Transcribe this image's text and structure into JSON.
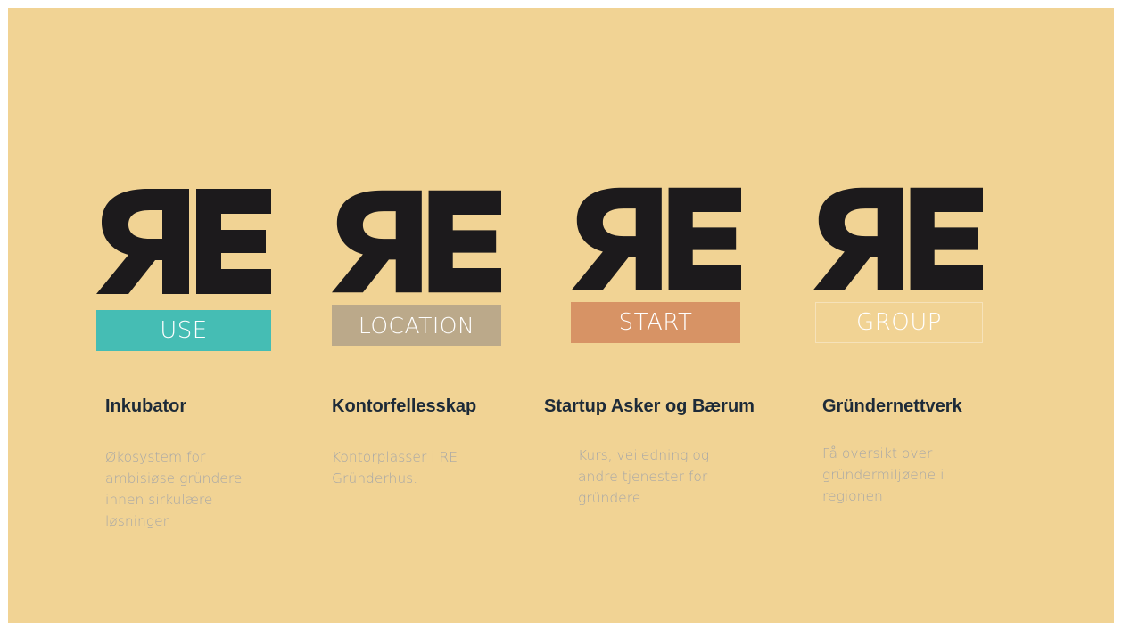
{
  "colors": {
    "background": "#f1d394",
    "logo": "#1c1a1c",
    "use": "#45bdb4",
    "location": "#bba98a",
    "start": "#d79365",
    "heading": "#1d2a38",
    "description": "#a7a7a7"
  },
  "columns": [
    {
      "logo_text": "ЯE",
      "tag": "USE",
      "heading": "Inkubator",
      "description": "Økosystem for\nambisiøse gründere\ninnen sirkulære\nløsninger"
    },
    {
      "logo_text": "ЯE",
      "tag": "LOCATION",
      "heading": "Kontorfellesskap",
      "description": "Kontorplasser i RE\nGründerhus."
    },
    {
      "logo_text": "ЯE",
      "tag": "START",
      "heading": "Startup Asker og Bærum",
      "description": "Kurs, veiledning og\nandre tjenester for\ngründere"
    },
    {
      "logo_text": "ЯE",
      "tag": "GROUP",
      "heading": "Gründernettverk",
      "description": "Få oversikt over\ngründermiljøene i\nregionen"
    }
  ]
}
